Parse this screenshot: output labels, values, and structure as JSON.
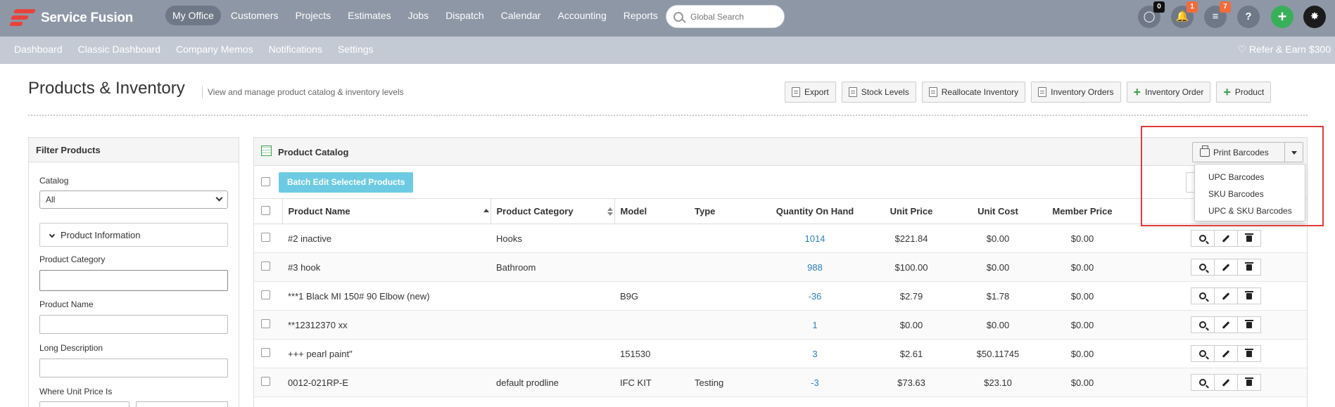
{
  "brand": {
    "name": "Service Fusion",
    "accent": "#e8433b"
  },
  "topnav": {
    "items": [
      "My Office",
      "Customers",
      "Projects",
      "Estimates",
      "Jobs",
      "Dispatch",
      "Calendar",
      "Accounting",
      "Reports"
    ],
    "active": "My Office",
    "search_placeholder": "Global Search",
    "chat_count": "0",
    "notification_count": "1",
    "tasks_count": "7",
    "help_label": "?",
    "add_label": "+"
  },
  "subnav": {
    "items": [
      "Dashboard",
      "Classic Dashboard",
      "Company Memos",
      "Notifications",
      "Settings"
    ],
    "refer_label": "Refer & Earn $300"
  },
  "page": {
    "title": "Products & Inventory",
    "subtitle": "View and manage product catalog & inventory levels",
    "actions": [
      {
        "label": "Export",
        "icon": "export-icon"
      },
      {
        "label": "Stock Levels",
        "icon": "doc-icon"
      },
      {
        "label": "Reallocate Inventory",
        "icon": "doc-icon"
      },
      {
        "label": "Inventory Orders",
        "icon": "doc-icon"
      },
      {
        "label": "Inventory Order",
        "icon": "plus-icon"
      },
      {
        "label": "Product",
        "icon": "plus-icon"
      }
    ]
  },
  "filter": {
    "title": "Filter Products",
    "catalog_label": "Catalog",
    "catalog_value": "All",
    "section_label": "Product Information",
    "category_label": "Product Category",
    "name_label": "Product Name",
    "long_desc_label": "Long Description",
    "unit_price_label": "Where Unit Price Is"
  },
  "catalog": {
    "title": "Product Catalog",
    "print_label": "Print Barcodes",
    "batch_label": "Batch Edit Selected Products",
    "dropdown": [
      "UPC Barcodes",
      "SKU Barcodes",
      "UPC & SKU Barcodes"
    ],
    "columns": [
      "Product Name",
      "Product Category",
      "Model",
      "Type",
      "Quantity On Hand",
      "Unit Price",
      "Unit Cost",
      "Member Price"
    ],
    "rows": [
      [
        "#2 inactive",
        "Hooks",
        "",
        "",
        "1014",
        "$221.84",
        "$0.00",
        "$0.00"
      ],
      [
        "#3 hook",
        "Bathroom",
        "",
        "",
        "988",
        "$100.00",
        "$0.00",
        "$0.00"
      ],
      [
        "***1 Black MI 150# 90 Elbow (new)",
        "",
        "B9G",
        "",
        "-36",
        "$2.79",
        "$1.78",
        "$0.00"
      ],
      [
        "**12312370 xx",
        "",
        "",
        "",
        "1",
        "$0.00",
        "$0.00",
        "$0.00"
      ],
      [
        "+++ pearl paint\"",
        "",
        "151530",
        "",
        "3",
        "$2.61",
        "$50.11745",
        "$0.00"
      ],
      [
        "0012-021RP-E",
        "default prodline",
        "IFC KIT",
        "Testing",
        "-3",
        "$73.63",
        "$23.10",
        "$0.00"
      ]
    ]
  }
}
